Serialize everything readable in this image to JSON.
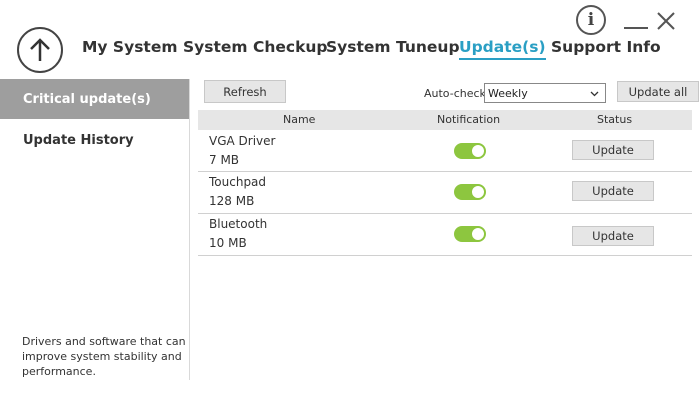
{
  "window_controls": {
    "info_glyph": "i"
  },
  "nav": {
    "tabs": [
      {
        "label": "My System"
      },
      {
        "label": "System Checkup"
      },
      {
        "label": "System Tuneup"
      },
      {
        "label": "Update(s)"
      },
      {
        "label": "Support Info"
      }
    ],
    "active_tab": "Update(s)"
  },
  "sidebar": {
    "items": [
      {
        "label": "Critical update(s)"
      },
      {
        "label": "Update History"
      }
    ],
    "footer": "Drivers and software that can improve system stability and performance."
  },
  "toolbar": {
    "refresh_label": "Refresh",
    "autocheck_label": "Auto-check",
    "autocheck_value": "Weekly",
    "update_all_label": "Update all"
  },
  "table": {
    "headers": {
      "name": "Name",
      "notification": "Notification",
      "status": "Status"
    },
    "rows": [
      {
        "name": "VGA Driver",
        "size": "7 MB",
        "notification_on": true,
        "action": "Update"
      },
      {
        "name": "Touchpad",
        "size": "128 MB",
        "notification_on": true,
        "action": "Update"
      },
      {
        "name": "Bluetooth",
        "size": "10 MB",
        "notification_on": true,
        "action": "Update"
      }
    ]
  },
  "colors": {
    "accent": "#2a9fc4",
    "toggle_on": "#8dc63f",
    "sidebar_active": "#9e9e9e"
  },
  "icons": [
    "info-icon",
    "minimize-icon",
    "close-icon",
    "up-arrow-icon",
    "chevron-down-icon"
  ]
}
